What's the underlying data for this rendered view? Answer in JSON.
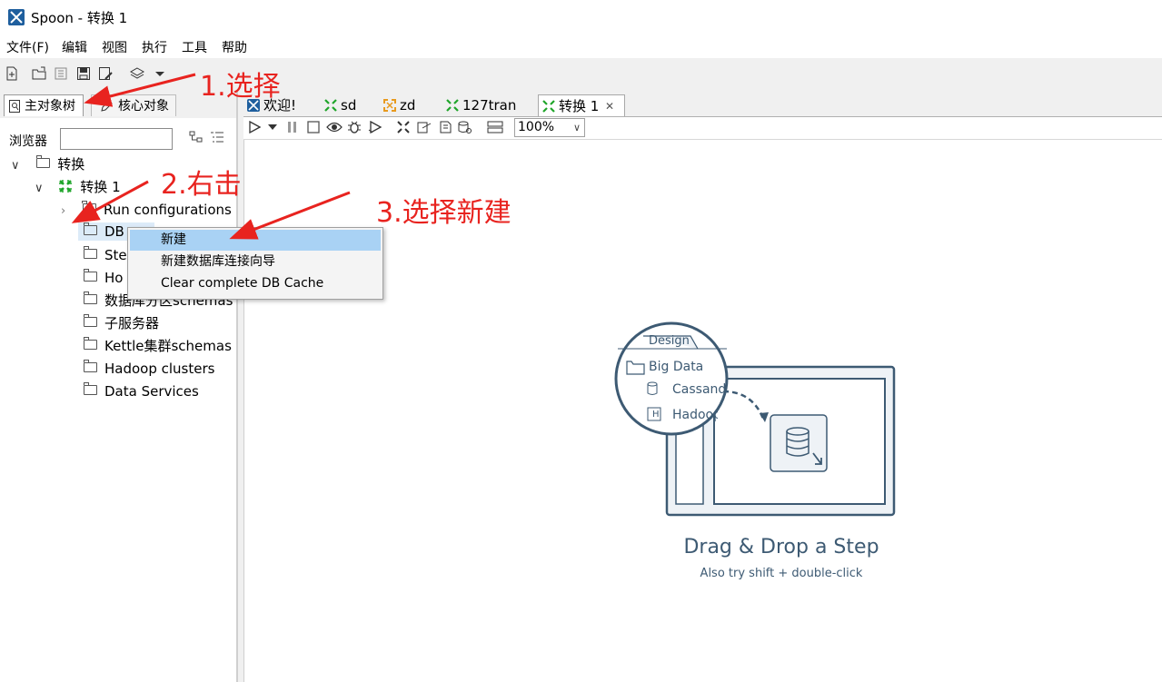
{
  "window": {
    "title": "Spoon - 转换 1"
  },
  "menu": [
    "文件(F)",
    "编辑",
    "视图",
    "执行",
    "工具",
    "帮助"
  ],
  "left_tabs": {
    "main_tree": "主对象树",
    "core_objects": "核心对象"
  },
  "browser": {
    "label": "浏览器",
    "search_value": ""
  },
  "tree": {
    "root": "转换",
    "transform": "转换 1",
    "children": [
      "Run configurations",
      "DB连接",
      "Steps",
      "Hops",
      "数据库分区schemas",
      "子服务器",
      "Kettle集群schemas",
      "Hadoop clusters",
      "Data Services"
    ],
    "visible_children": [
      "Run configurations",
      "DB",
      "Ste",
      "Ho",
      "数据库分区schemas",
      "子服务器",
      "Kettle集群schemas",
      "Hadoop clusters",
      "Data Services"
    ]
  },
  "context_menu": [
    "新建",
    "新建数据库连接向导",
    "Clear complete DB Cache"
  ],
  "editor_tabs": [
    "欢迎!",
    "sd",
    "zd",
    "127tran",
    "转换 1"
  ],
  "zoom": "100%",
  "canvas": {
    "design_tab": "Design",
    "big_data": "Big Data",
    "cassandra": "Cassandr",
    "hadoop": "Hadoop",
    "drag_title": "Drag & Drop a Step",
    "drag_sub": "Also try shift + double-click"
  },
  "annotations": [
    "1.选择",
    "2.右击",
    "3.选择新建"
  ],
  "colors": {
    "annotation": "#e8231f",
    "selection": "#a9d2f4",
    "illustration": "#3d5a73",
    "tree_green": "#1fa52a"
  }
}
